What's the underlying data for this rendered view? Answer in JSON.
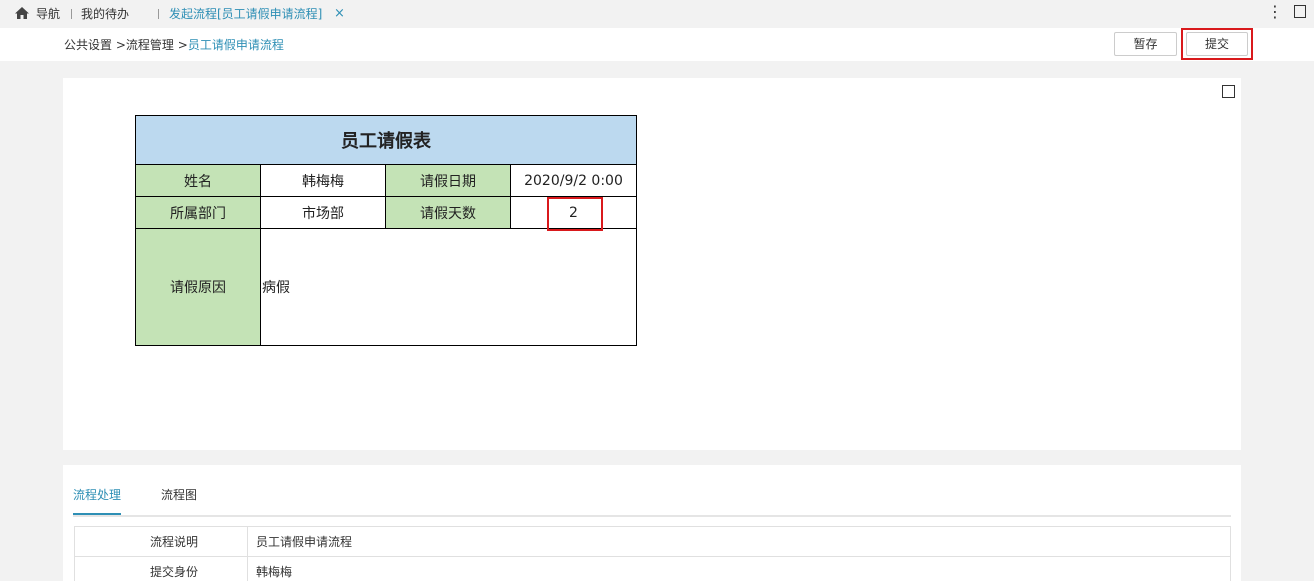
{
  "topbar": {
    "nav_label": "导航",
    "todo_label": "我的待办",
    "active_tab_label": "发起流程[员工请假申请流程]",
    "close_glyph": "×",
    "more_glyph": "⋮"
  },
  "breadcrumb": {
    "item1": "公共设置",
    "sep1": ">",
    "item2": "流程管理",
    "sep2": ">",
    "current": "员工请假申请流程"
  },
  "toolbar": {
    "save_draft_label": "暂存",
    "submit_label": "提交"
  },
  "form": {
    "title": "员工请假表",
    "name_label": "姓名",
    "name_value": "韩梅梅",
    "date_label": "请假日期",
    "date_value": "2020/9/2 0:00",
    "dept_label": "所属部门",
    "dept_value": "市场部",
    "days_label": "请假天数",
    "days_value": "2",
    "reason_label": "请假原因",
    "reason_value": "病假"
  },
  "process": {
    "tabs": [
      {
        "label": "流程处理"
      },
      {
        "label": "流程图"
      }
    ],
    "rows": [
      {
        "key": "流程说明",
        "value": "员工请假申请流程"
      },
      {
        "key": "提交身份",
        "value": "韩梅梅"
      }
    ]
  },
  "colors": {
    "accent": "#2e8fb5",
    "highlight": "#d9191c",
    "title_bg": "#bcd9ef",
    "label_bg": "#c4e3b6"
  }
}
